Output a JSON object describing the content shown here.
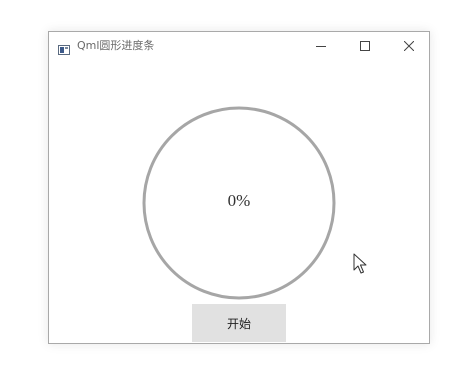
{
  "window": {
    "title": "Qml圆形进度条",
    "controls": {
      "minimize_icon": "minimize-icon",
      "maximize_icon": "maximize-icon",
      "close_icon": "close-icon"
    }
  },
  "progress": {
    "value": 0,
    "label": "0%",
    "ring_color": "#a6a6a6"
  },
  "start_button": {
    "label": "开始"
  },
  "colors": {
    "button_bg": "#e1e1e1",
    "window_border": "#a9a9a9"
  }
}
